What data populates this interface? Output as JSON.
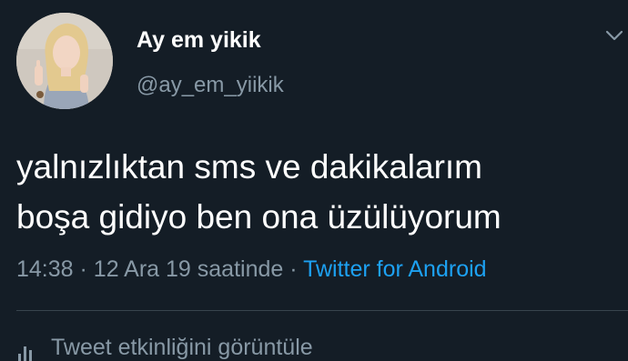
{
  "user": {
    "display_name": "Ay em yikik",
    "handle": "@ay_em_yiikik"
  },
  "tweet": {
    "lines": [
      "yalnızlıktan sms ve dakikalarım",
      "boşa gidiyo ben ona üzülüyorum"
    ],
    "time": "14:38",
    "separator": "·",
    "date": "12 Ara 19 saatinde",
    "source": "Twitter for Android"
  },
  "actions": {
    "activity_label": "Tweet etkinliğini görüntüle"
  },
  "icons": {
    "caret": "chevron-down-icon",
    "activity": "bar-chart-icon"
  },
  "colors": {
    "background": "#141d26",
    "text_primary": "#ffffff",
    "text_secondary": "#8899a6",
    "link": "#1da1f2",
    "divider": "#38444d"
  }
}
